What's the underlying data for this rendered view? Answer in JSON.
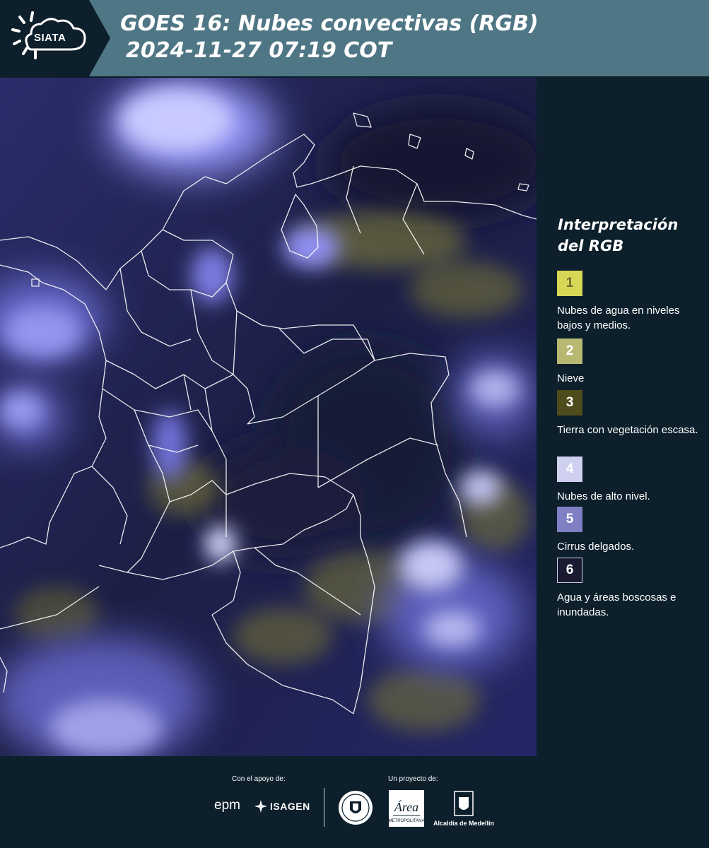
{
  "header": {
    "logo_text": "SIATA",
    "title_line1": "GOES 16: Nubes convectivas (RGB)",
    "title_line2": "2024-11-27 07:19 COT"
  },
  "legend": {
    "title": "Interpretación del RGB",
    "items": [
      {
        "number": "1",
        "label": "Nubes de agua en niveles bajos y medios.",
        "color": "#d8d857",
        "text_color": "#6b6b2a"
      },
      {
        "number": "2",
        "label": "Nieve",
        "color": "#b9b870",
        "text_color": "#ffffff"
      },
      {
        "number": "3",
        "label": "Tierra con vegetación escasa.",
        "color": "#4e4b1c",
        "text_color": "#ffffff"
      },
      {
        "number": "4",
        "label": "Nubes de alto nivel.",
        "color": "#cfd0f0",
        "text_color": "#ffffff"
      },
      {
        "number": "5",
        "label": "Cirrus delgados.",
        "color": "#7f80c4",
        "text_color": "#ffffff"
      },
      {
        "number": "6",
        "label": "Agua y áreas boscosas e inundadas.",
        "color": "#1a1b33",
        "text_color": "#ffffff"
      }
    ]
  },
  "footer": {
    "support_label": "Con el apoyo de:",
    "project_label": "Un proyecto de:",
    "epm_text": "epm",
    "isagen_text": "ISAGEN",
    "area_text": "Área",
    "area_subtext": "METROPOLITANA",
    "alcaldia_text": "Alcaldía de Medellín"
  }
}
